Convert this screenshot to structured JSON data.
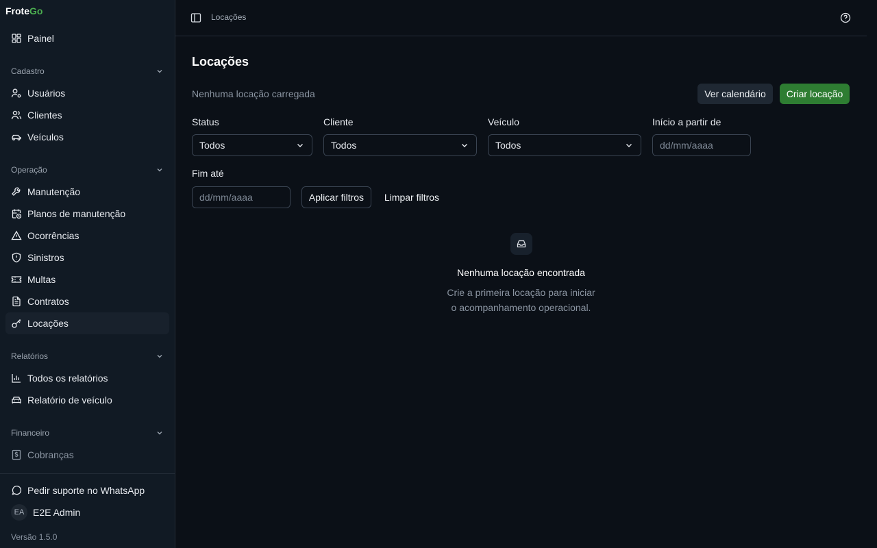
{
  "brand": {
    "part1": "Frote",
    "part2": "Go",
    "accent": "#4caf50"
  },
  "sidebar": {
    "painel": "Painel",
    "sections": {
      "cadastro": "Cadastro",
      "operacao": "Operação",
      "relatorios": "Relatórios",
      "financeiro": "Financeiro"
    },
    "items": {
      "usuarios": "Usuários",
      "clientes": "Clientes",
      "veiculos": "Veículos",
      "manutencao": "Manutenção",
      "planos": "Planos de manutenção",
      "ocorrencias": "Ocorrências",
      "sinistros": "Sinistros",
      "multas": "Multas",
      "contratos": "Contratos",
      "locacoes": "Locações",
      "todos_relatorios": "Todos os relatórios",
      "relatorio_veiculo": "Relatório de veículo",
      "cobrancas": "Cobranças"
    },
    "support": "Pedir suporte no WhatsApp",
    "user": {
      "initials": "EA",
      "name": "E2E Admin"
    },
    "version": "Versão 1.5.0"
  },
  "topbar": {
    "breadcrumb": "Locações"
  },
  "main": {
    "title": "Locações",
    "subtitle": "Nenhuma locação carregada",
    "calendar_button": "Ver calendário",
    "create_button": "Criar locação",
    "primary_color": "#2e7d32"
  },
  "filters": {
    "status_label": "Status",
    "status_value": "Todos",
    "cliente_label": "Cliente",
    "cliente_value": "Todos",
    "veiculo_label": "Veículo",
    "veiculo_value": "Todos",
    "inicio_label": "Início a partir de",
    "inicio_placeholder": "dd/mm/aaaa",
    "fim_label": "Fim até",
    "fim_placeholder": "dd/mm/aaaa",
    "apply_button": "Aplicar filtros",
    "clear_button": "Limpar filtros"
  },
  "empty": {
    "title": "Nenhuma locação encontrada",
    "line1": "Crie a primeira locação para iniciar",
    "line2": "o acompanhamento operacional."
  }
}
